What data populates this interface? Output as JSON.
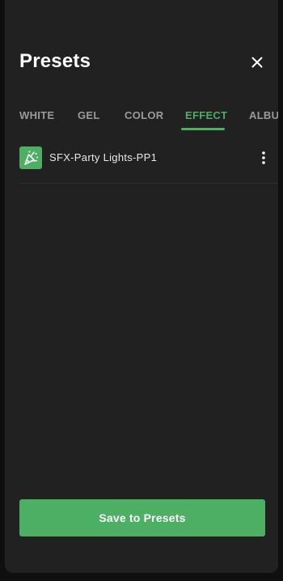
{
  "title": "Presets",
  "icons": {
    "close": "close-icon",
    "preset_item": "party-popper-icon",
    "more": "more-vertical-icon"
  },
  "tabs": [
    {
      "label": "WHITE",
      "active": false
    },
    {
      "label": "GEL",
      "active": false
    },
    {
      "label": "COLOR",
      "active": false
    },
    {
      "label": "EFFECT",
      "active": true
    },
    {
      "label": "ALBUM",
      "active": false
    }
  ],
  "presets": [
    {
      "name": "SFX-Party Lights-PP1"
    }
  ],
  "save_button": "Save to Presets",
  "colors": {
    "accent": "#4caf63",
    "background": "#212121",
    "text": "#ffffff"
  }
}
